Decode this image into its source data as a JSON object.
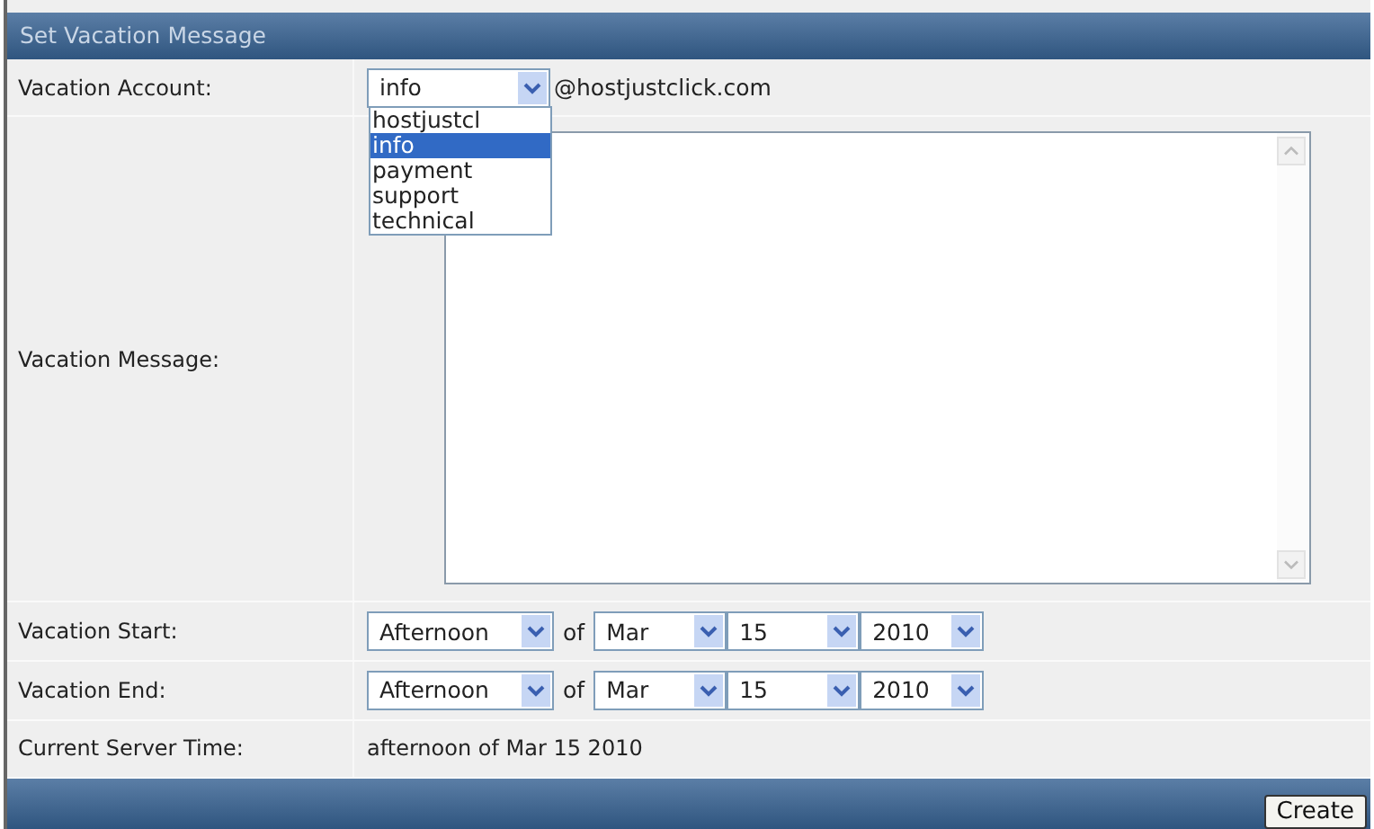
{
  "title": "Set Vacation Message",
  "account": {
    "label": "Vacation Account:",
    "value": "info",
    "domain": "@hostjustclick.com",
    "expanded": true,
    "options": [
      {
        "label": "hostjustcl",
        "selected": false
      },
      {
        "label": "info",
        "selected": true
      },
      {
        "label": "payment",
        "selected": false
      },
      {
        "label": "support",
        "selected": false
      },
      {
        "label": "technical",
        "selected": false
      }
    ]
  },
  "message": {
    "label": "Vacation Message:"
  },
  "dates": [
    {
      "label": "Vacation Start:",
      "period": "Afternoon",
      "joiner": "of",
      "month": "Mar",
      "day": "15",
      "year": "2010"
    },
    {
      "label": "Vacation End:",
      "period": "Afternoon",
      "joiner": "of",
      "month": "Mar",
      "day": "15",
      "year": "2010"
    }
  ],
  "server_time": {
    "label": "Current Server Time:",
    "value": "afternoon of Mar 15 2010"
  },
  "buttons": [
    "Create"
  ]
}
